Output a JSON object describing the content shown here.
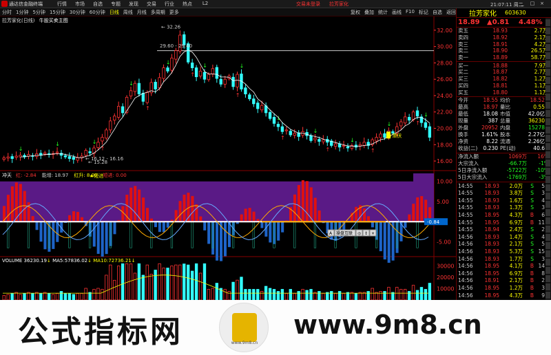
{
  "titlebar": {
    "app_name": "通达信金融终端",
    "menu": [
      "行情",
      "市场",
      "自选",
      "专题",
      "发现",
      "交易",
      "行业",
      "热点",
      "L2"
    ],
    "login": "交易未登录",
    "stock_name": "拉芳家化",
    "clock": "21:07:11",
    "day": "周二",
    "win_buttons": [
      "_",
      "□",
      "×"
    ]
  },
  "toolbar": {
    "periods": [
      "分时",
      "1分钟",
      "5分钟",
      "15分钟",
      "30分钟",
      "60分钟",
      "日线",
      "周线",
      "月线",
      "多周期",
      "更多"
    ],
    "active": "日线",
    "right_items": [
      "复权",
      "叠加",
      "统计",
      "画线",
      "F10",
      "标记",
      "自选",
      "返回"
    ]
  },
  "chart": {
    "title": "拉芳家化(日线)",
    "indicator_name": "牛股买卖主图",
    "y_labels": [
      "32.00",
      "30.00",
      "28.00",
      "26.00",
      "24.00",
      "22.00",
      "20.00",
      "18.00",
      "16.00"
    ],
    "annotations": {
      "high": "32.26",
      "range": "29.60 - 29.40",
      "low1": "16.12 - 16.16",
      "low2": "15.28",
      "buy_label": "★潜伏"
    },
    "colors": {
      "up": "#ff3333",
      "down": "#33ffff",
      "ma": "#ffffff"
    }
  },
  "indicator": {
    "name": "冲天",
    "items": [
      {
        "label": "红",
        "value": "-2.84",
        "color": "#ff3333"
      },
      {
        "label": "能增",
        "value": "18.97",
        "color": "#cccccc"
      },
      {
        "label": "红升",
        "value": "8.00",
        "color": "#ffff00"
      },
      {
        "label": "短进",
        "value": "0.00",
        "color": "#ff3333"
      }
    ],
    "y_labels": [
      "10.00",
      "5.00",
      "-5.00"
    ],
    "current": "-0.84",
    "marker": "★短进",
    "tool_buttons": [
      "A",
      "操盘互联",
      "◎",
      "↕",
      "×"
    ]
  },
  "volume": {
    "label": "VOLUME",
    "value": "36230.19",
    "ma5_label": "MA5",
    "ma5": "57836.02",
    "ma10_label": "MA10",
    "ma10": "72736.21",
    "y_labels": [
      "30000",
      "20000",
      "10000"
    ]
  },
  "quote": {
    "name": "拉芳家化",
    "code": "603630",
    "price": "18.89",
    "change": "▲0.81",
    "pct": "4.48%",
    "asks": [
      {
        "l": "卖五",
        "p": "18.93",
        "v": "2.7万"
      },
      {
        "l": "卖四",
        "p": "18.92",
        "v": "2.1万"
      },
      {
        "l": "卖三",
        "p": "18.91",
        "v": "4.2万"
      },
      {
        "l": "卖二",
        "p": "18.90",
        "v": "26.5万"
      },
      {
        "l": "卖一",
        "p": "18.89",
        "v": "58.7万"
      }
    ],
    "bids": [
      {
        "l": "买一",
        "p": "18.88",
        "v": "7.9万"
      },
      {
        "l": "买二",
        "p": "18.87",
        "v": "2.7万"
      },
      {
        "l": "买三",
        "p": "18.82",
        "v": "1.2万"
      },
      {
        "l": "买四",
        "p": "18.81",
        "v": "1.1万"
      },
      {
        "l": "买五",
        "p": "18.80",
        "v": "1.1万"
      }
    ],
    "stats": [
      {
        "a": "今开",
        "b": "18.55",
        "bc": "#ff3333",
        "c": "均价",
        "d": "18.52",
        "dc": "#ff3333"
      },
      {
        "a": "最高",
        "b": "18.97",
        "bc": "#ff3333",
        "c": "量比",
        "d": "0.55",
        "dc": "#ffff00"
      },
      {
        "a": "最低",
        "b": "18.08",
        "bc": "#ffffff",
        "c": "市值",
        "d": "42.0亿",
        "dc": "#ffffff"
      },
      {
        "a": "现量",
        "b": "387",
        "bc": "#ffffff",
        "c": "总量",
        "d": "36230",
        "dc": "#ffff00"
      },
      {
        "a": "外盘",
        "b": "20952",
        "bc": "#ff3333",
        "c": "内盘",
        "d": "15278",
        "dc": "#22ff22"
      },
      {
        "a": "换手",
        "b": "1.61%",
        "bc": "#ffffff",
        "c": "股本",
        "d": "2.27亿",
        "dc": "#ffffff"
      },
      {
        "a": "净资",
        "b": "8.22",
        "bc": "#ffffff",
        "c": "流通",
        "d": "2.26亿",
        "dc": "#ffffff"
      },
      {
        "a": "收益(二)",
        "b": "0.230",
        "bc": "#ffffff",
        "c": "PE(动)",
        "d": "40.6",
        "dc": "#ffffff"
      }
    ],
    "flows": [
      {
        "a": "净流入额",
        "b": "1069万",
        "bc": "#ff3333",
        "c": "16%",
        "cc": "#ff3333"
      },
      {
        "a": "大宗流入",
        "b": "-66.7万",
        "bc": "#22ff22",
        "c": "-1%",
        "cc": "#22ff22"
      },
      {
        "a": "5日净流入额",
        "b": "-5722万",
        "bc": "#22ff22",
        "c": "-10%",
        "cc": "#22ff22"
      },
      {
        "a": "5日大宗流入",
        "b": "-1769万",
        "bc": "#22ff22",
        "c": "-3%",
        "cc": "#22ff22"
      }
    ],
    "ticks": [
      {
        "t": "14:55",
        "p": "18.93",
        "v": "2.0万",
        "s": "S",
        "sc": "#22ff22",
        "n": "5"
      },
      {
        "t": "14:55",
        "p": "18.93",
        "v": "3.8万",
        "s": "S",
        "sc": "#22ff22",
        "n": "3"
      },
      {
        "t": "14:55",
        "p": "18.93",
        "v": "1.6万",
        "s": "S",
        "sc": "#22ff22",
        "n": "4"
      },
      {
        "t": "14:55",
        "p": "18.93",
        "v": "1.3万",
        "s": "S",
        "sc": "#22ff22",
        "n": "3"
      },
      {
        "t": "14:55",
        "p": "18.95",
        "v": "4.3万",
        "s": "B",
        "sc": "#ff3333",
        "n": "6"
      },
      {
        "t": "14:55",
        "p": "18.95",
        "v": "6.9万",
        "s": "B",
        "sc": "#ff3333",
        "n": "11"
      },
      {
        "t": "14:55",
        "p": "18.94",
        "v": "2.4万",
        "s": "S",
        "sc": "#22ff22",
        "n": "2"
      },
      {
        "t": "14:56",
        "p": "18.93",
        "v": "1.4万",
        "s": "S",
        "sc": "#22ff22",
        "n": "4"
      },
      {
        "t": "14:56",
        "p": "18.93",
        "v": "2.1万",
        "s": "S",
        "sc": "#22ff22",
        "n": "5"
      },
      {
        "t": "14:56",
        "p": "18.93",
        "v": "5.3万",
        "s": "S",
        "sc": "#22ff22",
        "n": "15"
      },
      {
        "t": "14:56",
        "p": "18.93",
        "v": "1.7万",
        "s": "S",
        "sc": "#22ff22",
        "n": "3"
      },
      {
        "t": "14:56",
        "p": "18.95",
        "v": "4.1万",
        "s": "B",
        "sc": "#ff3333",
        "n": "14"
      },
      {
        "t": "14:56",
        "p": "18.95",
        "v": "6.9万",
        "s": "B",
        "sc": "#ff3333",
        "n": "8"
      },
      {
        "t": "14:56",
        "p": "18.91",
        "v": "2.1万",
        "s": "B",
        "sc": "#ff3333",
        "n": "2"
      },
      {
        "t": "14:56",
        "p": "18.95",
        "v": "1.2万",
        "s": "B",
        "sc": "#ff3333",
        "n": "3"
      },
      {
        "t": "14:56",
        "p": "18.95",
        "v": "4.3万",
        "s": "B",
        "sc": "#ff3333",
        "n": "9"
      }
    ]
  },
  "watermark": {
    "left_text": "公式指标网",
    "right_text": "www.9m8.cn",
    "logo_caption": "www.9m8.cn"
  }
}
